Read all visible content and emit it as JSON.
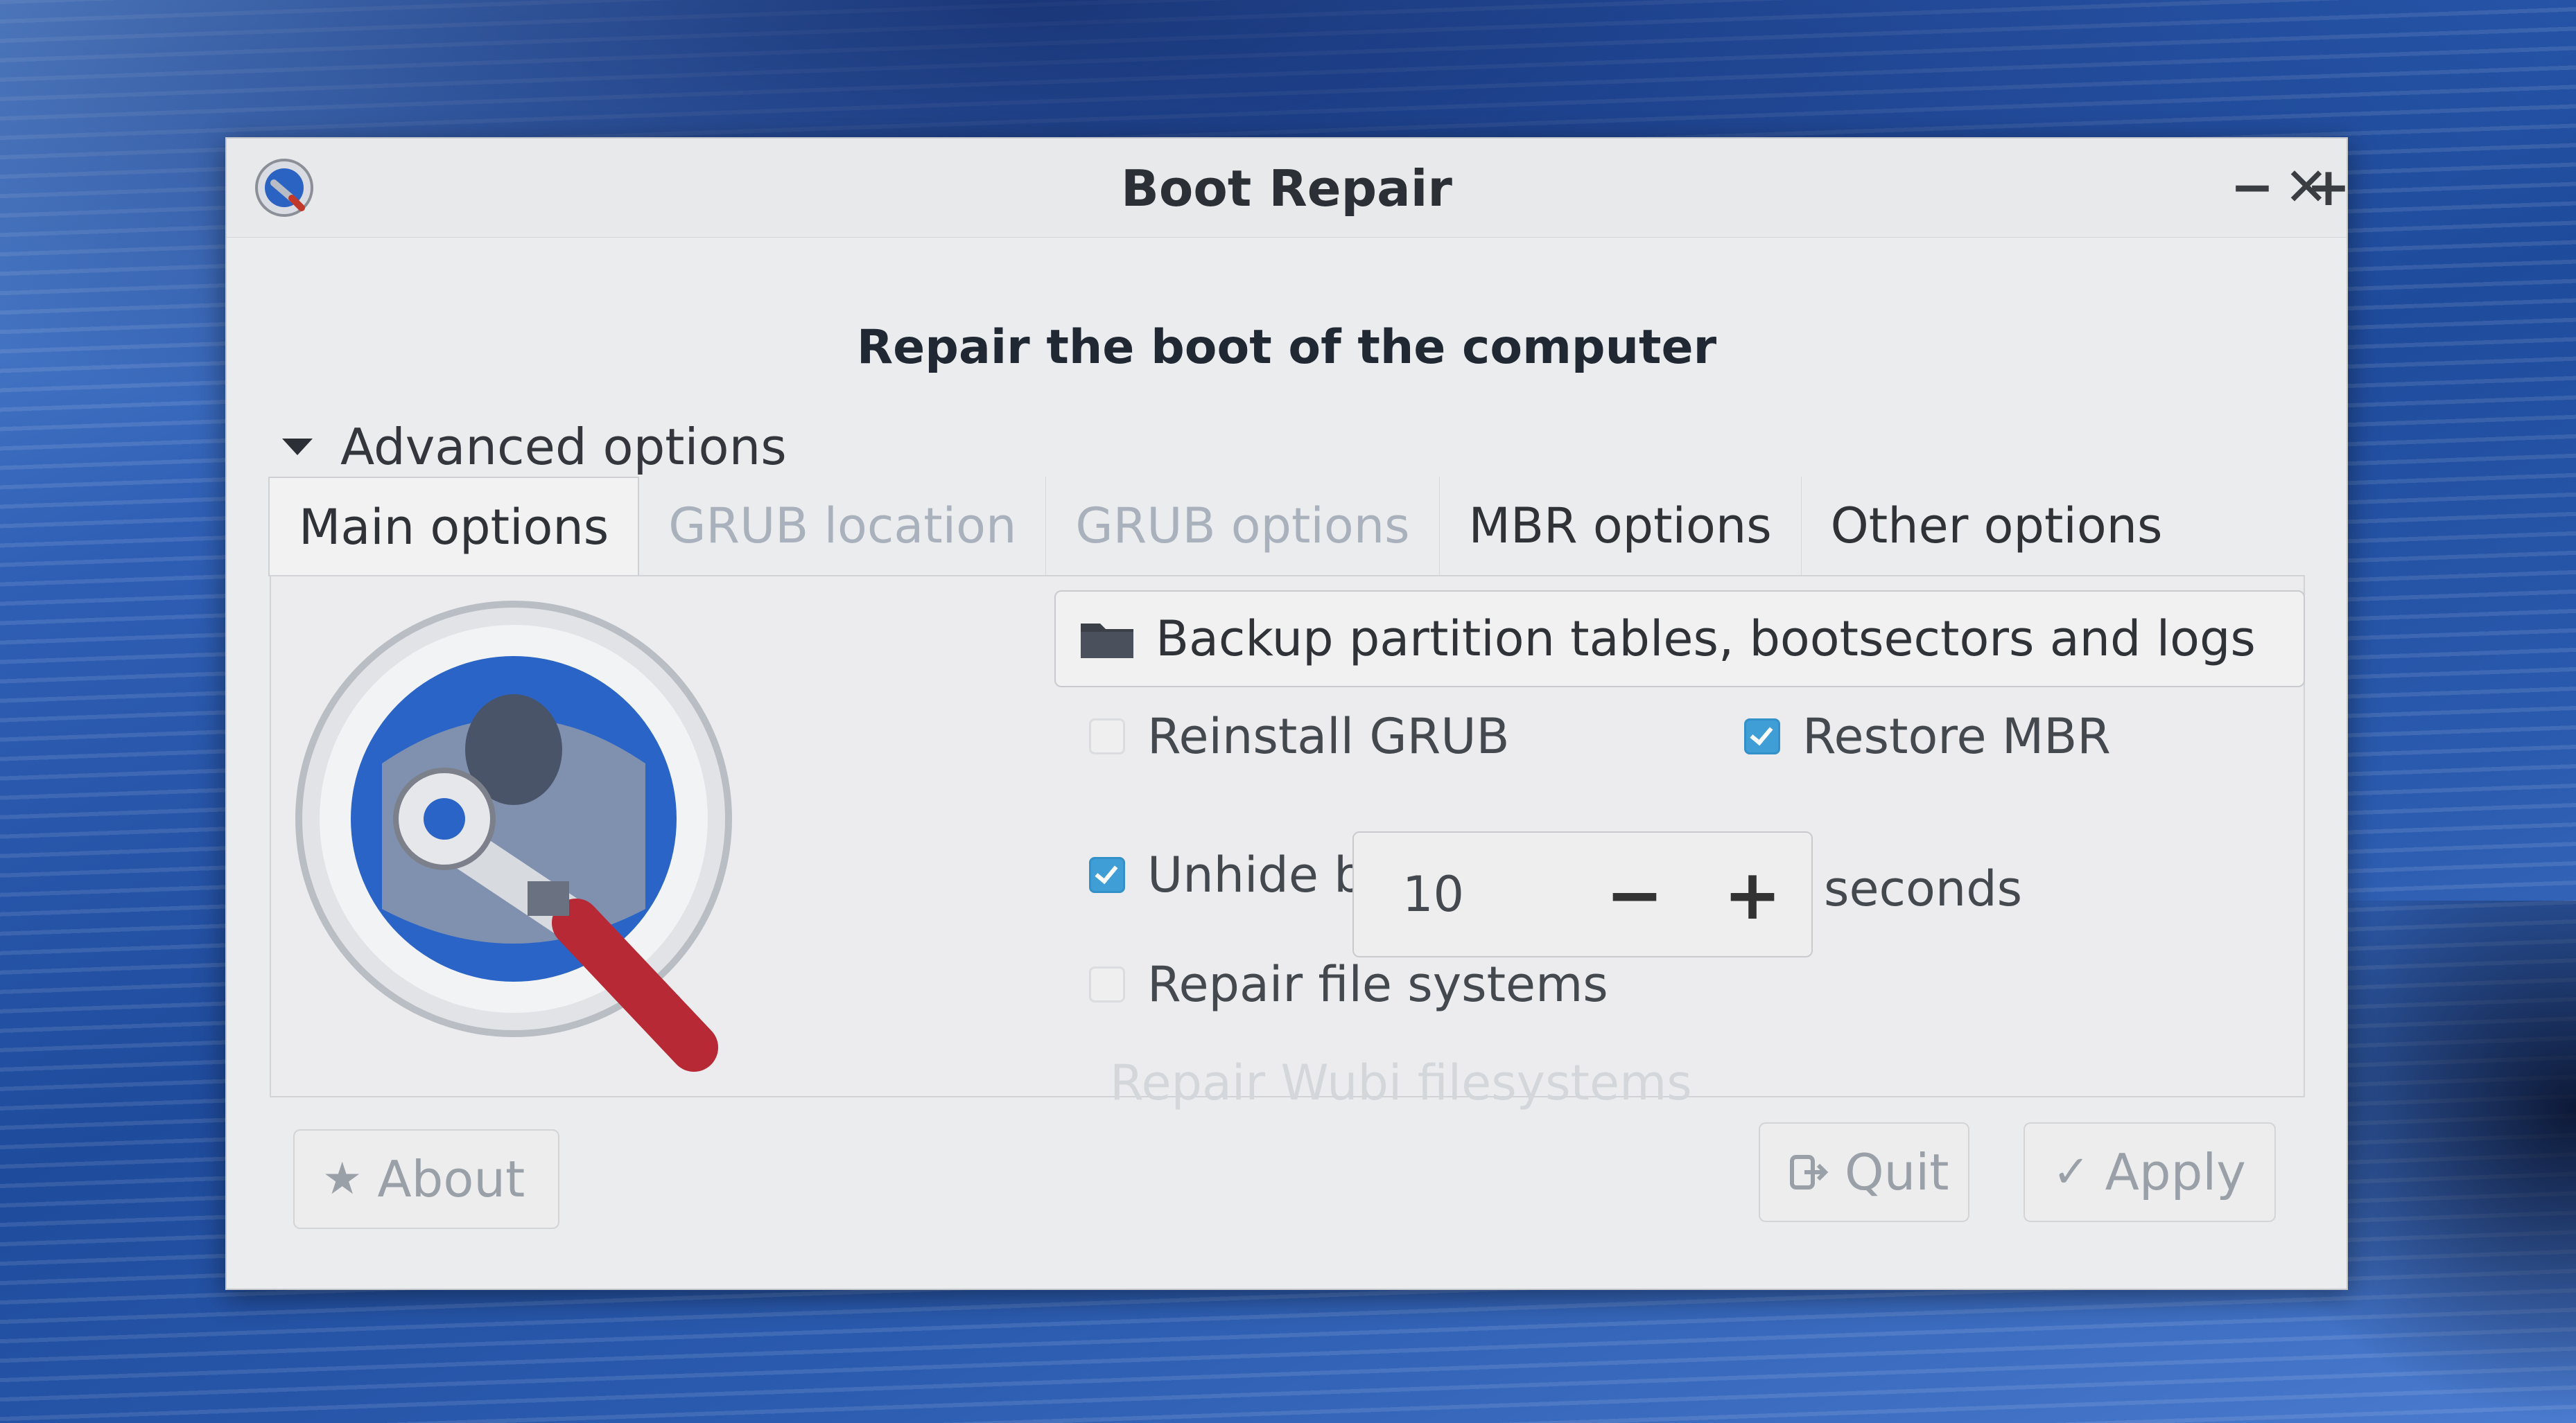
{
  "window": {
    "title": "Boot Repair",
    "controls": {
      "minimize": "−",
      "maximize": "+",
      "close": "✕"
    }
  },
  "headline": "Repair the boot of the computer",
  "expander": {
    "label": "Advanced options",
    "icon": "triangle-down-icon"
  },
  "tabs": [
    {
      "label": "Main options",
      "state": "active"
    },
    {
      "label": "GRUB location",
      "state": "disabled"
    },
    {
      "label": "GRUB options",
      "state": "disabled"
    },
    {
      "label": "MBR options",
      "state": "enabled"
    },
    {
      "label": "Other options",
      "state": "enabled"
    }
  ],
  "main": {
    "backup_button": "Backup partition tables, bootsectors and logs",
    "reinstall_grub": {
      "label": "Reinstall GRUB",
      "checked": false
    },
    "restore_mbr": {
      "label": "Restore MBR",
      "checked": true
    },
    "unhide_boot_menu": {
      "label": "Unhide boot menu :",
      "checked": true,
      "value": "10",
      "minus": "−",
      "plus": "+",
      "unit": "seconds"
    },
    "repair_fs": {
      "label": "Repair file systems",
      "checked": false
    },
    "repair_wubi": {
      "label": "Repair Wubi filesystems"
    }
  },
  "footer": {
    "about": "About",
    "quit": "Quit",
    "apply": "Apply"
  },
  "colors": {
    "check_accent": "#3f9ed6",
    "window_bg": "#ebeced"
  }
}
